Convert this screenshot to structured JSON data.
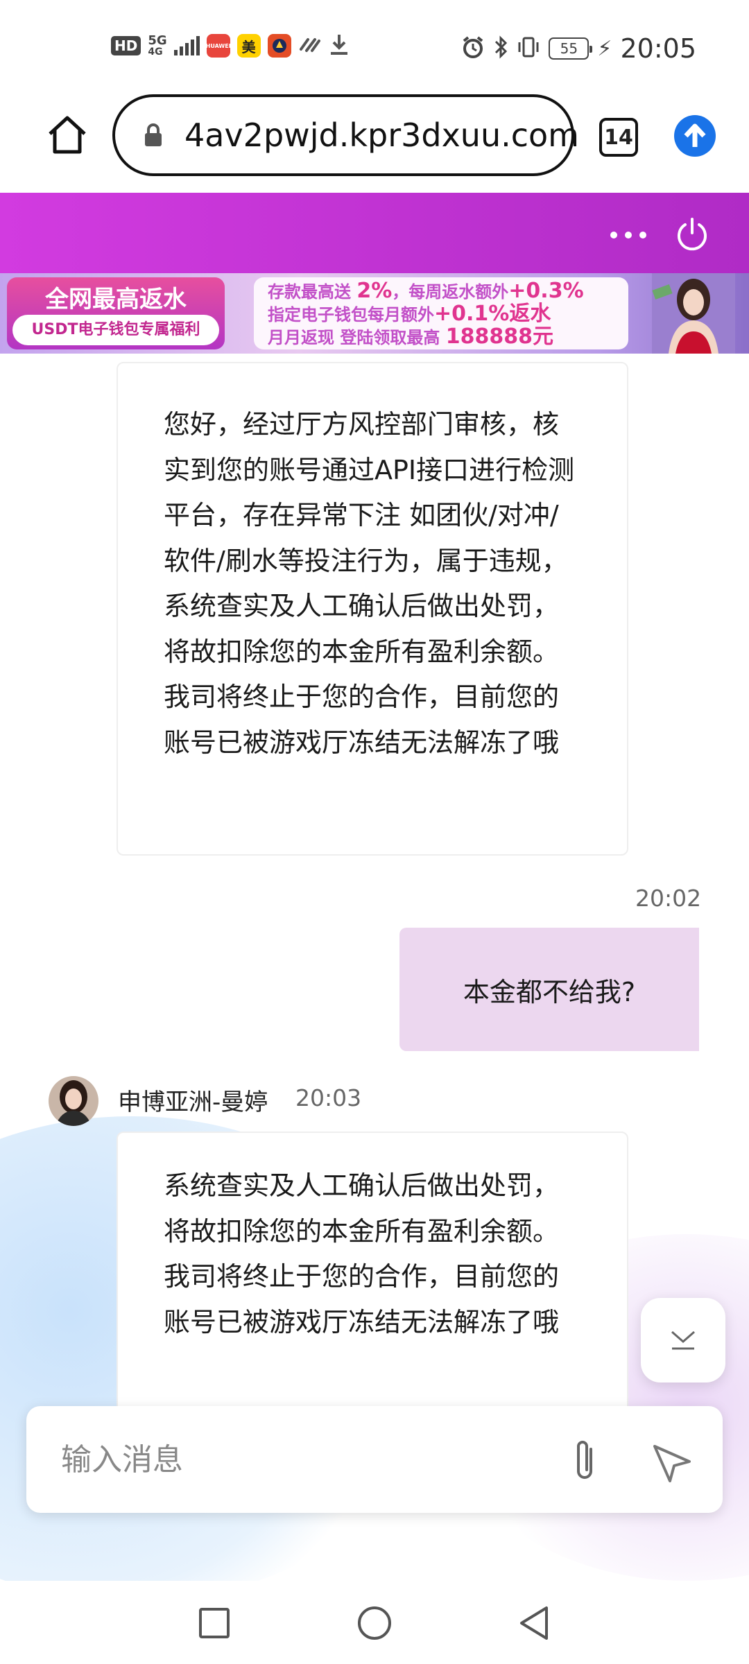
{
  "status_bar": {
    "hd": "HD",
    "network": "5G",
    "network_sub": "4G",
    "meituan": "美",
    "huawei_label": "HUAWEI",
    "battery": "55",
    "time": "20:05"
  },
  "browser": {
    "url": "4av2pwjd.kpr3dxuu.com",
    "tab_count": "14"
  },
  "banner": {
    "title": "全网最高返水",
    "pill": "USDT电子钱包专属福利",
    "line1_prefix": "存款最高送",
    "line1_hi1": "2%",
    "line1_mid": "，每周返水额外",
    "line1_hi2": "+0.3%",
    "line2_prefix": "指定电子钱包每月额外",
    "line2_hi": "+0.1%返水",
    "line3_prefix": "月月返现 登陆领取最高",
    "line3_hi": "188888元"
  },
  "messages": [
    {
      "type": "incoming",
      "text": "您好，经过厅方风控部门审核，核实到您的账号通过API接口进行检测平台，存在异常下注 如团伙/对冲/软件/刷水等投注行为，属于违规，系统查实及人工确认后做出处罚，将故扣除您的本金所有盈利余额。 我司将终止于您的合作，目前您的账号已被游戏厅冻结无法解冻了哦"
    },
    {
      "type": "outgoing",
      "time": "20:02",
      "text": "本金都不给我?"
    },
    {
      "type": "incoming",
      "sender": "申博亚洲-曼婷",
      "time": "20:03",
      "text": "系统查实及人工确认后做出处罚，将故扣除您的本金所有盈利余额。 我司将终止于您的合作，目前您的账号已被游戏厅冻结无法解冻了哦"
    }
  ],
  "composer": {
    "placeholder": "输入消息"
  },
  "colors": {
    "header_purple": "#c833d6",
    "outgoing_bubble": "#ecd7ef",
    "browser_accent": "#1a73e8"
  },
  "icons": {
    "home": "home-icon",
    "lock": "lock-icon",
    "tabs": "tabs-icon",
    "upload": "upload-arrow-icon",
    "more": "more-dots-icon",
    "power": "power-icon",
    "scroll_down": "chevron-down-icon",
    "attach": "paperclip-icon",
    "send": "send-icon"
  }
}
